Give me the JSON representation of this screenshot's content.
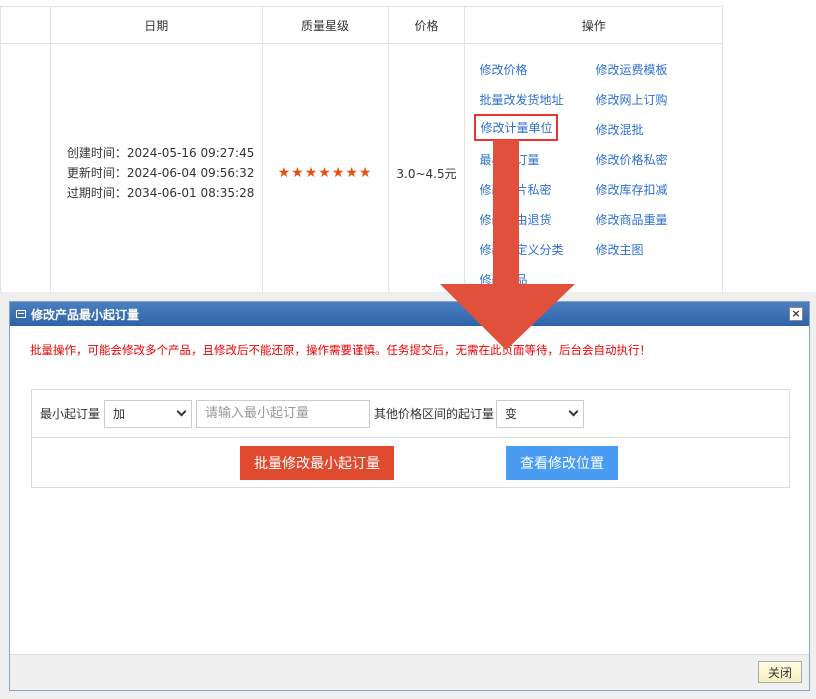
{
  "table": {
    "headers": {
      "date": "日期",
      "stars": "质量星级",
      "price": "价格",
      "ops": "操作"
    },
    "row": {
      "created": "创建时间：2024-05-16 09:27:45",
      "updated": "更新时间：2024-06-04 09:56:32",
      "expires": "过期时间：2034-06-01 08:35:28",
      "stars": "★★★★★★★",
      "price": "3.0~4.5元"
    },
    "ops_left": [
      "修改价格",
      "批量改发货地址",
      "修改计量单位",
      "最小起订量",
      "修改图片私密",
      "修改理由退货",
      "修改自定义分类",
      "修改产品"
    ],
    "ops_right": [
      "修改运费模板",
      "修改网上订购",
      "修改混批",
      "修改价格私密",
      "修改库存扣减",
      "修改商品重量",
      "修改主图"
    ]
  },
  "dialog": {
    "title": "修改产品最小起订量",
    "close_x": "×",
    "warning": "批量操作，可能会修改多个产品，且修改后不能还原，操作需要谨慎。任务提交后，无需在此页面等待，后台会自动执行！",
    "form": {
      "moq_label": "最小起订量",
      "op_select_value": "加",
      "moq_placeholder": "请输入最小起订量",
      "other_label": "其他价格区间的起订量",
      "other_select_value": "变"
    },
    "buttons": {
      "batch_modify": "批量修改最小起订量",
      "view_position": "查看修改位置",
      "close": "关闭"
    }
  },
  "colors": {
    "link": "#2e6fd1",
    "warning": "#ee0000",
    "primary_red": "#e04a2f",
    "primary_blue": "#4a9cf2",
    "arrow": "#e0503a",
    "dialog_header": "#2e63a8"
  }
}
